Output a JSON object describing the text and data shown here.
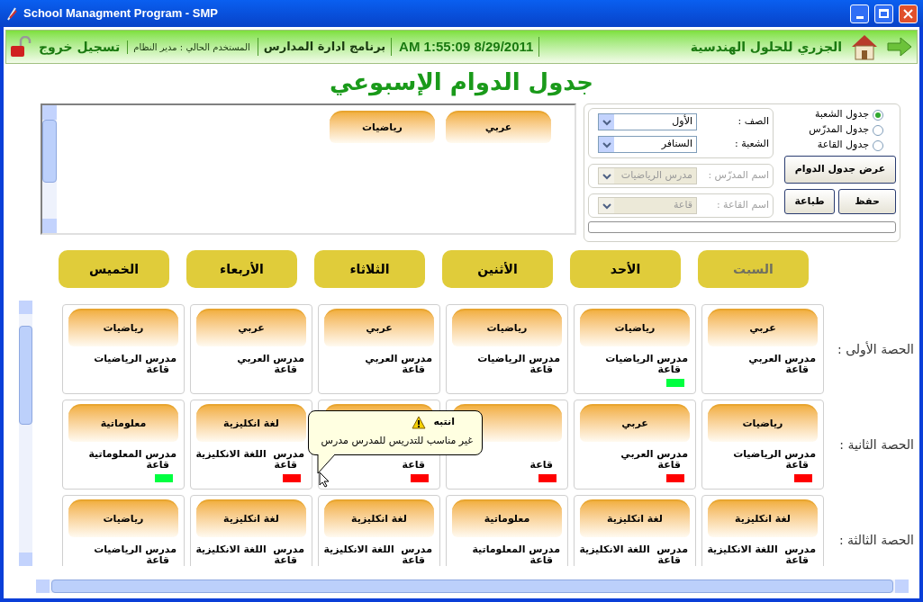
{
  "window": {
    "title": "School Managment Program - SMP"
  },
  "header": {
    "company": "الجزري للحلول الهندسية",
    "datetime": "AM 1:55:09 8/29/2011",
    "program": "برنامج ادارة المدارس",
    "user": "المستخدم الحالي : مدير النظام",
    "logout": "تسجيل خروج"
  },
  "page_title": "جدول الدوام الإسبوعي",
  "subject_palette": [
    "عربي",
    "رياضيات"
  ],
  "view_options": [
    {
      "label": "جدول الشعبة",
      "selected": true
    },
    {
      "label": "جدول المدرّس",
      "selected": false
    },
    {
      "label": "جدول القاعة",
      "selected": false
    }
  ],
  "filters": [
    {
      "label": "الصف :",
      "value": "الأول",
      "disabled": false
    },
    {
      "label": "الشعبة :",
      "value": "السنافر",
      "disabled": false
    }
  ],
  "lookups": [
    {
      "label": "اسم المدرّس :",
      "value": "مدرس الرياضيات",
      "disabled": true
    },
    {
      "label": "اسم القاعة :",
      "value": "قاعة",
      "disabled": true
    }
  ],
  "show_button": "عرض جدول الدوام",
  "buttons": [
    "حفظ",
    "طباعة"
  ],
  "progress": {
    "level": 0
  },
  "days": [
    {
      "label": "السبت",
      "selected": true
    },
    {
      "label": "الأحد",
      "selected": false
    },
    {
      "label": "الأثنين",
      "selected": false
    },
    {
      "label": "الثلاثاء",
      "selected": false
    },
    {
      "label": "الأربعاء",
      "selected": false
    },
    {
      "label": "الخميس",
      "selected": false
    }
  ],
  "periods": [
    {
      "label": "الحصة الأولى :",
      "cells": [
        {
          "subject": "عربي",
          "teacher": "مدرس العربي",
          "room": "قاعة"
        },
        {
          "subject": "رياضيات",
          "teacher": "مدرس الرياضيات",
          "room": "قاعة",
          "color": "#00ff40"
        },
        {
          "subject": "رياضيات",
          "teacher": "مدرس الرياضيات",
          "room": "قاعة"
        },
        {
          "subject": "عربي",
          "teacher": "مدرس العربي",
          "room": "قاعة"
        },
        {
          "subject": "عربي",
          "teacher": "مدرس العربي",
          "room": "قاعة"
        },
        {
          "subject": "رياضيات",
          "teacher": "مدرس الرياضيات",
          "room": "قاعة"
        }
      ]
    },
    {
      "label": "الحصة الثانية :",
      "cells": [
        {
          "subject": "رياضيات",
          "teacher": "مدرس الرياضيات",
          "room": "قاعة",
          "color": "#ff0000"
        },
        {
          "subject": "عربي",
          "teacher": "مدرس العربي",
          "room": "قاعة",
          "color": "#ff0000"
        },
        {
          "room": "قاعة",
          "color": "#ff0000"
        },
        {
          "room": "قاعة",
          "color": "#ff0000"
        },
        {
          "subject": "لغة انكليزية",
          "teacher": "مدرس  اللغة الانكليزية",
          "room": "قاعة",
          "color": "#ff0000"
        },
        {
          "subject": "معلوماتية",
          "teacher": "مدرس المعلوماتية",
          "room": "قاعة",
          "color": "#00ff40"
        }
      ]
    },
    {
      "label": "الحصة الثالثة :",
      "cells": [
        {
          "subject": "لغة انكليزية",
          "teacher": "مدرس  اللغة الانكليزية",
          "room": "قاعة"
        },
        {
          "subject": "لغة انكليزية",
          "teacher": "مدرس  اللغة الانكليزية",
          "room": "قاعة"
        },
        {
          "subject": "معلوماتية",
          "teacher": "مدرس المعلوماتية",
          "room": "قاعة"
        },
        {
          "subject": "لغة انكليزية",
          "teacher": "مدرس  اللغة الانكليزية",
          "room": "قاعة"
        },
        {
          "subject": "لغة انكليزية",
          "teacher": "مدرس  اللغة الانكليزية",
          "room": "قاعة"
        },
        {
          "subject": "رياضيات",
          "teacher": "مدرس الرياضيات",
          "room": "قاعة"
        }
      ]
    }
  ],
  "tooltip": {
    "title": "انتبه",
    "message": "غير مناسب للتدريس للمدرس مدرس"
  }
}
